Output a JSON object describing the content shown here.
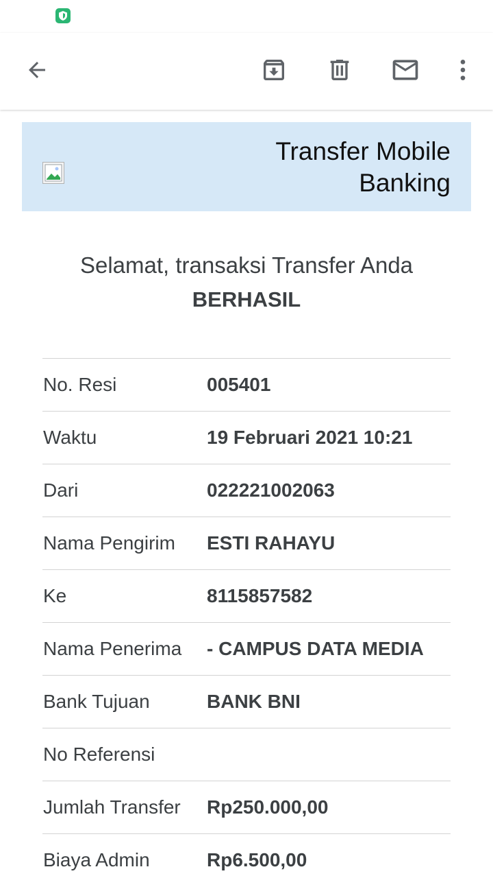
{
  "status_bar": {
    "icons": [
      "shield-icon"
    ]
  },
  "toolbar": {
    "icons": [
      "arrow-back-icon",
      "archive-icon",
      "delete-icon",
      "mail-icon",
      "more-vert-icon"
    ]
  },
  "banner": {
    "title_line1": "Transfer Mobile",
    "title_line2": "Banking",
    "image": "broken-image-icon"
  },
  "headline": {
    "text": "Selamat, transaksi Transfer Anda",
    "status": "BERHASIL"
  },
  "details": [
    {
      "label": "No. Resi",
      "value": "005401"
    },
    {
      "label": "Waktu",
      "value": "19 Februari 2021 10:21"
    },
    {
      "label": "Dari",
      "value": "022221002063"
    },
    {
      "label": "Nama Pengirim",
      "value": "ESTI RAHAYU"
    },
    {
      "label": "Ke",
      "value": "8115857582"
    },
    {
      "label": "Nama Penerima",
      "value": "- CAMPUS DATA MEDIA"
    },
    {
      "label": "Bank Tujuan",
      "value": "BANK BNI"
    },
    {
      "label": "No Referensi",
      "value": ""
    },
    {
      "label": "Jumlah Transfer",
      "value": "Rp250.000,00"
    },
    {
      "label": "Biaya Admin",
      "value": "Rp6.500,00"
    }
  ],
  "colors": {
    "banner_bg": "#d6e8f7",
    "status_icon": "#2bb673",
    "text": "#3c4043"
  }
}
